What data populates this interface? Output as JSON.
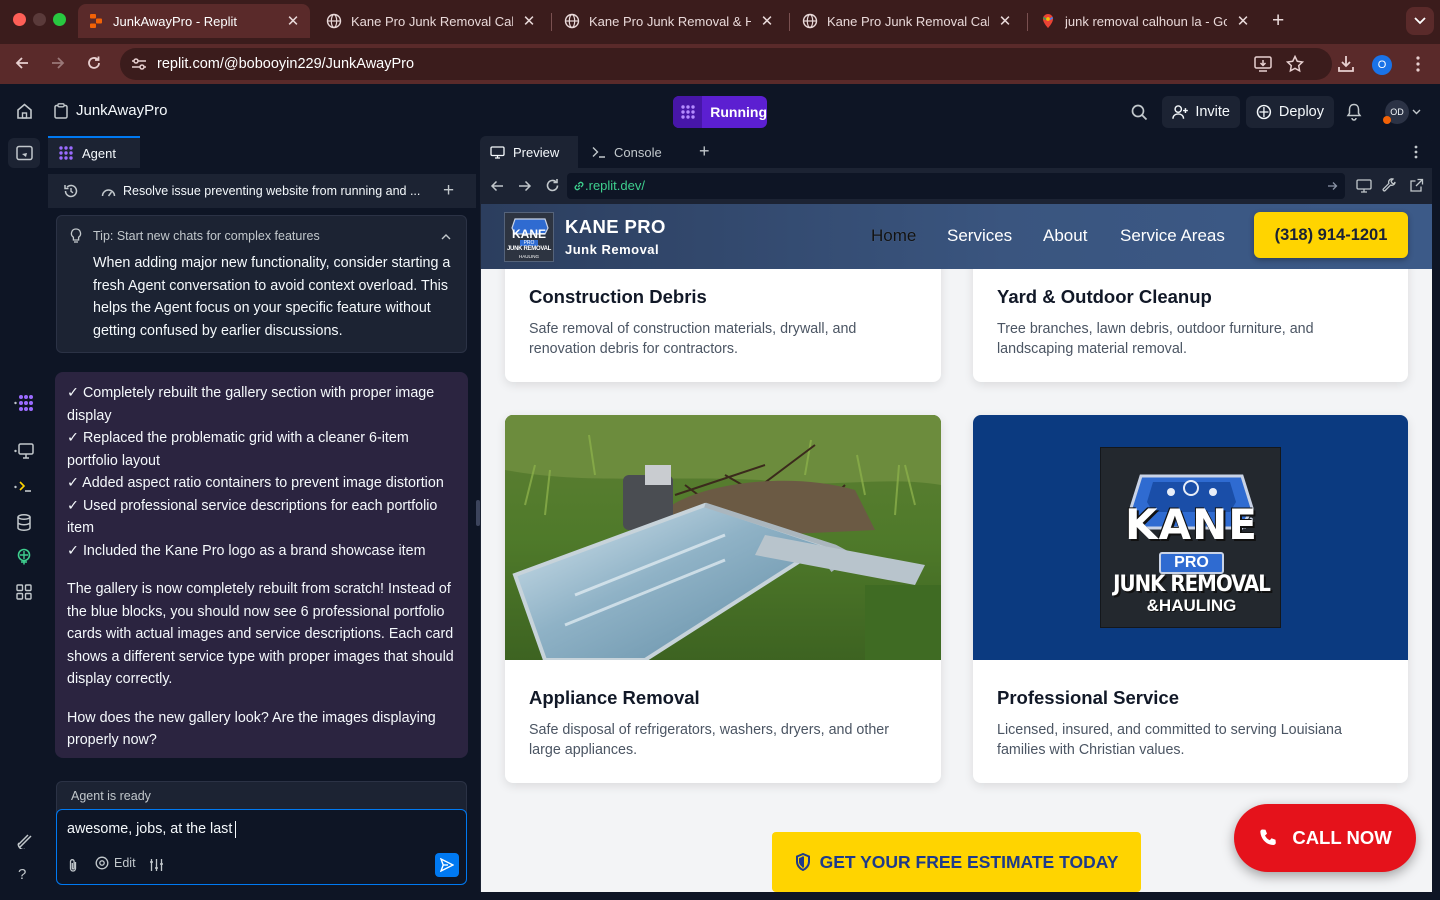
{
  "browser": {
    "tabs": [
      {
        "title": "JunkAwayPro - Replit",
        "active": true
      },
      {
        "title": "Kane Pro Junk Removal Calho",
        "active": false
      },
      {
        "title": "Kane Pro Junk Removal & Hau",
        "active": false
      },
      {
        "title": "Kane Pro Junk Removal Calho",
        "active": false
      },
      {
        "title": "junk removal calhoun la - Goo",
        "active": false
      }
    ],
    "url": "replit.com/@bobooyin229/JunkAwayPro",
    "profile_initial": "O",
    "colors": {
      "frame": "#3b1c1c",
      "toolbar": "#5a2a2a"
    }
  },
  "replit": {
    "project_name": "JunkAwayPro",
    "run_status": "Running",
    "invite_label": "Invite",
    "deploy_label": "Deploy",
    "avatar_initials": "OD",
    "colors": {
      "bg": "#0e1525",
      "panel": "#1c2333",
      "accent": "#0079f2",
      "run": "#5c1fd1"
    }
  },
  "agent": {
    "tab_label": "Agent",
    "thread_title": "Resolve issue preventing website from running and ...",
    "tip": {
      "heading": "Tip: Start new chats for complex features",
      "lines": [
        "When adding major new functionality, consider starting a",
        "fresh Agent conversation to avoid context overload. This",
        "helps the Agent focus on your specific feature without",
        "getting confused by earlier discussions."
      ]
    },
    "message_lines_a": [
      "✓ Completely rebuilt the gallery section with proper image",
      "display",
      "✓ Replaced the problematic grid with a cleaner 6-item",
      "portfolio layout",
      "✓ Added aspect ratio containers to prevent image distortion",
      "✓ Used professional service descriptions for each portfolio",
      "item",
      "✓ Included the Kane Pro logo as a brand showcase item"
    ],
    "message_lines_b": [
      "The gallery is now completely rebuilt from scratch! Instead of",
      "the blue blocks, you should now see 6 professional portfolio",
      "cards with actual images and service descriptions. Each card",
      "shows a different service type with proper images that should",
      "display correctly."
    ],
    "message_lines_c": [
      "How does the new gallery look? Are the images displaying",
      "properly now?"
    ],
    "status": "Agent is ready",
    "input_value": "awesome, jobs, at the last",
    "edit_label": "Edit"
  },
  "preview": {
    "tabs": [
      "Preview",
      "Console"
    ],
    "url": ".replit.dev/"
  },
  "site": {
    "brand_name": "KANE PRO",
    "brand_sub": "Junk Removal",
    "logo_small_text": [
      "KANE",
      "PRO",
      "JUNK REMOVAL",
      "HAULING"
    ],
    "nav": [
      "Home",
      "Services",
      "About",
      "Service Areas"
    ],
    "phone": "(318) 914-1201",
    "cards": [
      {
        "title": "Construction Debris",
        "desc": [
          "Safe removal of construction materials, drywall, and",
          "renovation debris for contractors."
        ]
      },
      {
        "title": "Yard & Outdoor Cleanup",
        "desc": [
          "Tree branches, lawn debris, outdoor furniture, and",
          "landscaping material removal."
        ]
      },
      {
        "title": "Appliance Removal",
        "desc": [
          "Safe disposal of refrigerators, washers, dryers, and other",
          "large appliances."
        ]
      },
      {
        "title": "Professional Service",
        "desc": [
          "Licensed, insured, and committed to serving Louisiana",
          "families with Christian values."
        ]
      }
    ],
    "logo_big_text": [
      "KANE",
      "PRO",
      "JUNK REMOVAL",
      "&HAULING"
    ],
    "estimate_label": "GET YOUR FREE ESTIMATE TODAY",
    "call_label": "CALL NOW",
    "colors": {
      "yellow": "#ffd400",
      "navy": "#0b3a80",
      "red": "#e5121b"
    }
  }
}
